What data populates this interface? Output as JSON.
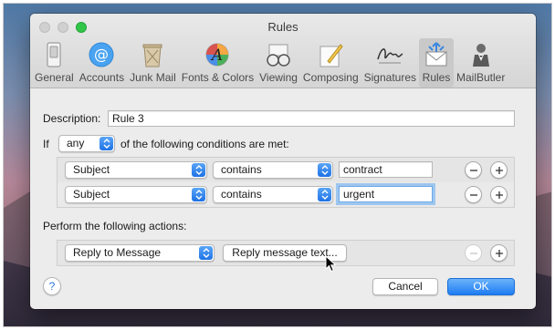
{
  "window": {
    "title": "Rules"
  },
  "toolbar": {
    "items": [
      {
        "label": "General",
        "icon": "general-switch-icon"
      },
      {
        "label": "Accounts",
        "icon": "at-sign-icon"
      },
      {
        "label": "Junk Mail",
        "icon": "trash-bin-icon"
      },
      {
        "label": "Fonts & Colors",
        "icon": "font-palette-icon"
      },
      {
        "label": "Viewing",
        "icon": "glasses-icon"
      },
      {
        "label": "Composing",
        "icon": "pencil-paper-icon"
      },
      {
        "label": "Signatures",
        "icon": "signature-icon"
      },
      {
        "label": "Rules",
        "icon": "rules-envelope-icon",
        "active": true
      },
      {
        "label": "MailButler",
        "icon": "butler-icon"
      }
    ]
  },
  "rule": {
    "description_label": "Description:",
    "description_value": "Rule 3",
    "if_label": "If",
    "match_value": "any",
    "conditions_suffix": "of the following conditions are met:",
    "conditions": [
      {
        "field": "Subject",
        "operator": "contains",
        "value": "contract"
      },
      {
        "field": "Subject",
        "operator": "contains",
        "value": "urgent"
      }
    ],
    "actions_label": "Perform the following actions:",
    "actions": [
      {
        "action": "Reply to Message",
        "button": "Reply message text..."
      }
    ]
  },
  "footer": {
    "help": "?",
    "cancel": "Cancel",
    "ok": "OK"
  },
  "colors": {
    "accent": "#1e7cf2",
    "focus_ring": "#9dc6ef",
    "zoom_green": "#30c748"
  }
}
